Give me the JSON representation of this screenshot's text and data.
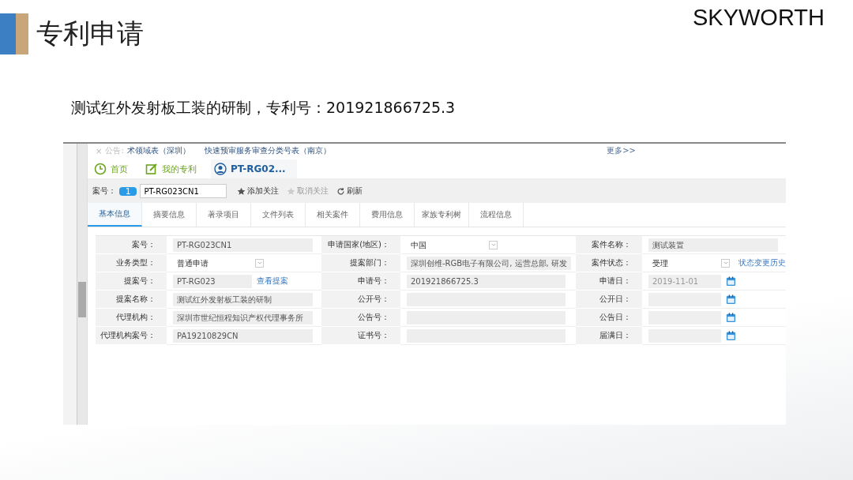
{
  "slide": {
    "title": "专利申请",
    "logo": "SKYWORTH",
    "caption": "测试红外发射板工装的研制，专利号：201921866725.3"
  },
  "notice": {
    "close": "×",
    "label": "公告:",
    "items": [
      "术领域表（深圳）",
      "快速预审服务审查分类号表（南京）"
    ],
    "more": "更多>>"
  },
  "tabs": [
    {
      "label": "首页",
      "selected": false
    },
    {
      "label": "我的专利",
      "selected": false
    },
    {
      "label": "PT-RG02...",
      "selected": true
    }
  ],
  "toolbar": {
    "label": "案号：",
    "badge": "1",
    "value": "PT-RG023CN1",
    "actions": [
      {
        "label": "添加关注",
        "disabled": false
      },
      {
        "label": "取消关注",
        "disabled": true
      },
      {
        "label": "刷新",
        "disabled": false
      }
    ]
  },
  "subtabs": [
    {
      "label": "基本信息",
      "selected": true
    },
    {
      "label": "摘要信息",
      "selected": false
    },
    {
      "label": "著录项目",
      "selected": false
    },
    {
      "label": "文件列表",
      "selected": false
    },
    {
      "label": "相关案件",
      "selected": false
    },
    {
      "label": "费用信息",
      "selected": false
    },
    {
      "label": "家族专利树",
      "selected": false
    },
    {
      "label": "流程信息",
      "selected": false
    }
  ],
  "form": [
    [
      {
        "label": "案号：",
        "kind": "text",
        "value": "PT-RG023CN1"
      },
      {
        "label": "申请国家(地区)：",
        "kind": "select",
        "value": "中国"
      },
      {
        "label": "案件名称：",
        "kind": "text",
        "value": "测试装置"
      }
    ],
    [
      {
        "label": "业务类型：",
        "kind": "select",
        "value": "普通申请"
      },
      {
        "label": "提案部门：",
        "kind": "text",
        "value": "深圳创维-RGB电子有限公司, 运营总部, 研发"
      },
      {
        "label": "案件状态：",
        "kind": "select",
        "value": "受理",
        "link": "状态变更历史"
      }
    ],
    [
      {
        "label": "提案号：",
        "kind": "text",
        "value": "PT-RG023",
        "link": "查看提案"
      },
      {
        "label": "申请号：",
        "kind": "text",
        "value": "201921866725.3"
      },
      {
        "label": "申请日：",
        "kind": "date",
        "value": "2019-11-01"
      }
    ],
    [
      {
        "label": "提案名称：",
        "kind": "text",
        "value": "测试红外发射板工装的研制"
      },
      {
        "label": "公开号：",
        "kind": "text"
      },
      {
        "label": "公开日：",
        "kind": "date"
      }
    ],
    [
      {
        "label": "代理机构：",
        "kind": "text",
        "value": "深圳市世纪恒程知识产权代理事务所"
      },
      {
        "label": "公告号：",
        "kind": "text"
      },
      {
        "label": "公告日：",
        "kind": "date"
      }
    ],
    [
      {
        "label": "代理机构案号：",
        "kind": "text",
        "value": "PA19210829CN"
      },
      {
        "label": "证书号：",
        "kind": "text"
      },
      {
        "label": "届满日：",
        "kind": "date"
      }
    ]
  ]
}
